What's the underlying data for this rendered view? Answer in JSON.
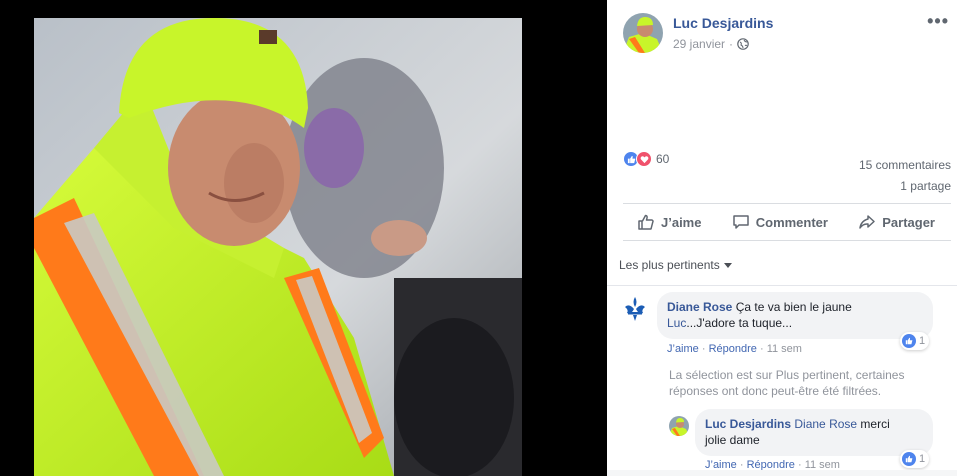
{
  "post": {
    "author": "Luc Desjardins",
    "date": "29 janvier",
    "privacy_icon": "globe-icon",
    "more_icon": "ellipsis-icon"
  },
  "stats": {
    "reaction_count": "60",
    "comments": "15 commentaires",
    "shares": "1 partage"
  },
  "actions": {
    "like": "J’aime",
    "comment": "Commenter",
    "share": "Partager"
  },
  "sort": {
    "label": "Les plus pertinents"
  },
  "comments": [
    {
      "author": "Diane Rose",
      "text_line1": "Ça te va bien le jaune",
      "tag": "Luc",
      "text_line2": "...J'adore ta tuque...",
      "like_label": "J’aime",
      "reply_label": "Répondre",
      "age": "11 sem",
      "likes": "1"
    }
  ],
  "filter_note": "La sélection est sur Plus pertinent, certaines réponses ont donc peut-être été filtrées.",
  "replies": [
    {
      "author": "Luc Desjardins",
      "tag": "Diane Rose",
      "text_line1": "merci",
      "text_line2": "jolie dame",
      "like_label": "J’aime",
      "reply_label": "Répondre",
      "age": "11 sem",
      "likes": "1"
    }
  ],
  "colors": {
    "link_blue": "#385898",
    "like_blue": "#4e84ed",
    "love_red": "#f0526c",
    "safety_yellow": "#c8f52a",
    "reflective_orange": "#ff7a1a"
  }
}
